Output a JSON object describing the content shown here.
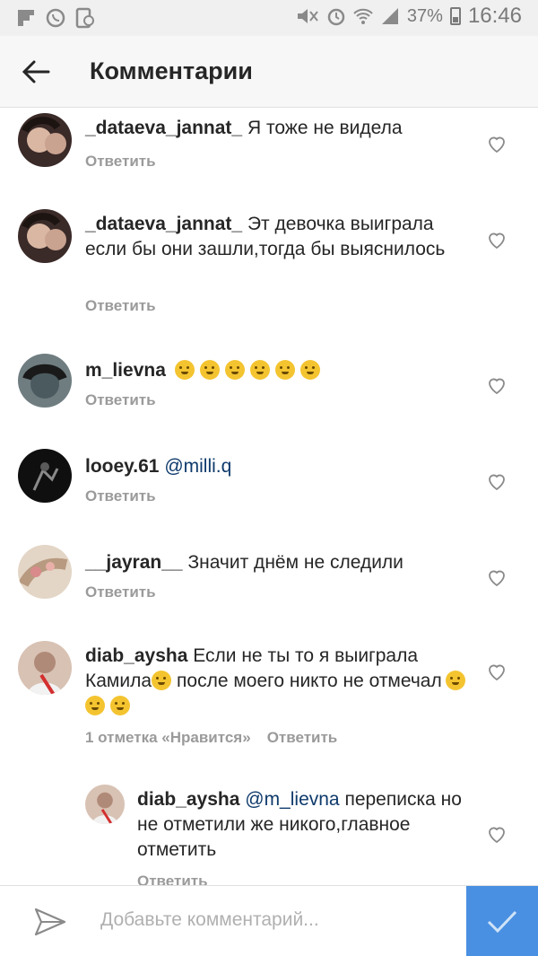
{
  "status_bar": {
    "battery": "37%",
    "time": "16:46"
  },
  "header": {
    "title": "Комментарии"
  },
  "comments": [
    {
      "username": "_dataeva_jannat_",
      "text": "Я тоже не видела",
      "reply_label": "Ответить",
      "avatar_color": "#3a2a28"
    },
    {
      "username": "_dataeva_jannat_",
      "text": "Эт девочка выиграла если бы они зашли,тогда бы выяснилось",
      "reply_label": "Ответить",
      "avatar_color": "#3a2a28"
    },
    {
      "username": "m_lievna",
      "text": "",
      "emoji_count": 6,
      "reply_label": "Ответить",
      "avatar_color": "#4b5a5f"
    },
    {
      "username": "looey.61",
      "text": "",
      "mention": "@milli.q",
      "reply_label": "Ответить",
      "avatar_color": "#0f0f0f"
    },
    {
      "username": "__jayran__",
      "text": "Значит днём не следили",
      "reply_label": "Ответить",
      "avatar_color": "#c9b6a0"
    },
    {
      "username": "diab_aysha",
      "text_part1": "Если не ты то я выиграла Камила",
      "text_part2": "после моего никто не отмечал",
      "likes_label": "1 отметка «Нравится»",
      "reply_label": "Ответить",
      "avatar_color": "#b08a78"
    },
    {
      "username": "diab_aysha",
      "mention": "@m_lievna",
      "text": "переписка но не отметили же никого,главное отметить",
      "reply_label": "Ответить",
      "avatar_color": "#b08a78"
    }
  ],
  "composer": {
    "placeholder": "Добавьте комментарий..."
  },
  "colors": {
    "accent": "#4a90e2",
    "mention": "#0e3a6b",
    "meta": "#9a9a9a"
  },
  "icons": [
    "back-arrow-icon",
    "heart-icon",
    "send-icon",
    "checkmark-icon"
  ]
}
